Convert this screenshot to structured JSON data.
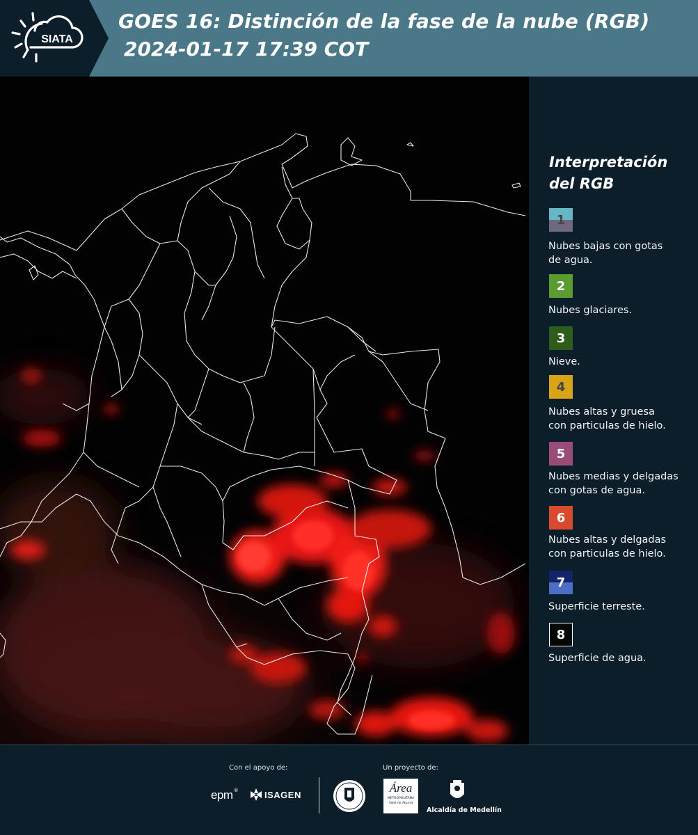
{
  "header": {
    "title_line1": "GOES 16: Distinción de la fase de la nube (RGB)",
    "title_line2": "2024-01-17 17:39 COT",
    "logo_text": "SIATA",
    "logo_icon": "sun-cloud-icon",
    "background_color": "#4a7889",
    "logo_background_color": "#0c1e2a"
  },
  "legend": {
    "title_line1": "Interpretación",
    "title_line2": "del RGB",
    "items": [
      {
        "number": "1",
        "label_line1": "Nubes bajas con gotas",
        "label_line2": "de agua.",
        "color_top": "#66b7c5",
        "color_bottom": "#6f6980",
        "number_color": "#444444"
      },
      {
        "number": "2",
        "label_line1": "Nubes glaciares.",
        "label_line2": "",
        "color_top": "#5a9b32",
        "color_bottom": "#5a9b32",
        "number_color": "#ffffff"
      },
      {
        "number": "3",
        "label_line1": "Nieve.",
        "label_line2": "",
        "color_top": "#2e5c1d",
        "color_bottom": "#2e5c1d",
        "number_color": "#ffffff"
      },
      {
        "number": "4",
        "label_line1": "Nubes altas y gruesa",
        "label_line2": "con particulas de hielo.",
        "color_top": "#d9a418",
        "color_bottom": "#d9a418",
        "number_color": "#444444"
      },
      {
        "number": "5",
        "label_line1": "Nubes medias y delgadas",
        "label_line2": "con gotas de agua.",
        "color_top": "#9a4c78",
        "color_bottom": "#9a4c78",
        "number_color": "#ffffff"
      },
      {
        "number": "6",
        "label_line1": "Nubes altas y delgadas",
        "label_line2": "con particulas de hielo.",
        "color_top": "#d84a2b",
        "color_bottom": "#d84a2b",
        "number_color": "#ffffff"
      },
      {
        "number": "7",
        "label_line1": "Superficie terreste.",
        "label_line2": "",
        "color_top": "#14246a",
        "color_bottom": "#4a6fc4",
        "number_color": "#ffffff"
      },
      {
        "number": "8",
        "label_line1": "Superficie de agua.",
        "label_line2": "",
        "color_top": "#050805",
        "color_bottom": "#050805",
        "number_color": "#ffffff"
      }
    ]
  },
  "footer": {
    "support_caption": "Con el apoyo de:",
    "project_caption": "Un proyecto de:",
    "sponsor_epm": "epm",
    "sponsor_isagen": "ISAGEN",
    "area_logo_text": "Área",
    "area_logo_sub1": "METROPOLITANA",
    "area_logo_sub2": "Valle de Aburrá",
    "alcaldia_label": "Alcaldía de Medellín"
  }
}
